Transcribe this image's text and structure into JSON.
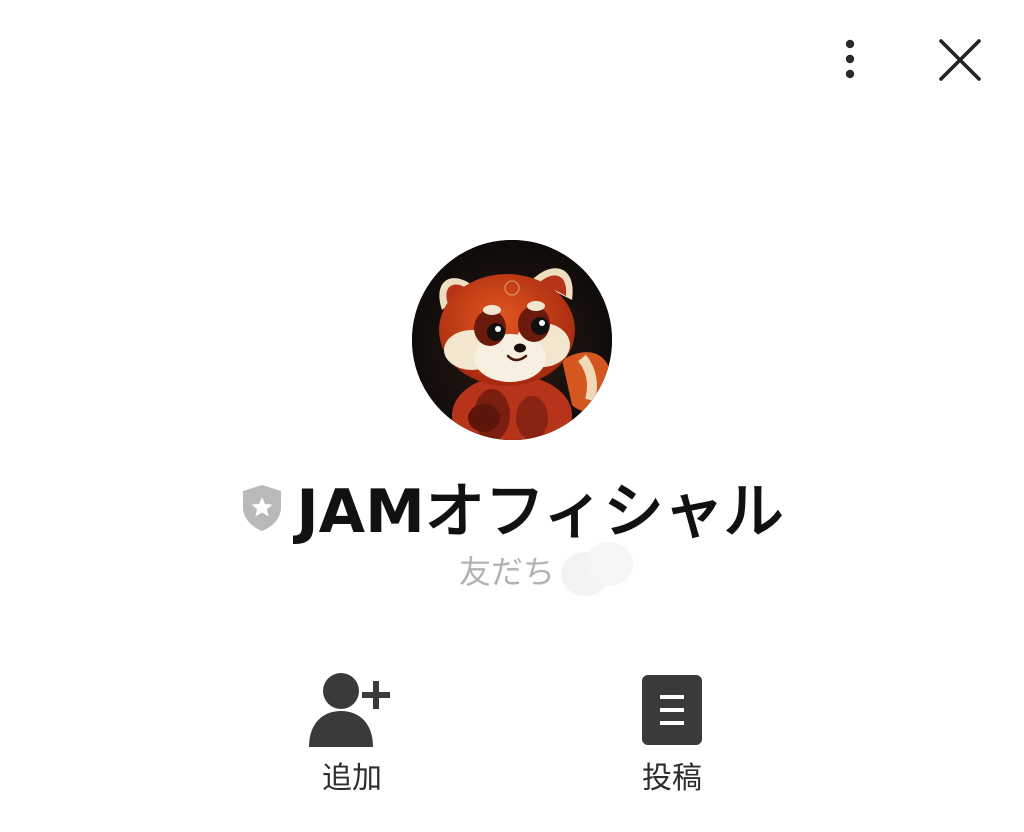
{
  "header": {
    "more_icon": "more-vertical-icon",
    "close_icon": "close-icon"
  },
  "profile": {
    "avatar_description": "red-panda-avatar",
    "badge_icon": "shield-star-icon",
    "name": "JAMオフィシャル",
    "friend_label": "友だち"
  },
  "actions": [
    {
      "label": "追加",
      "icon": "add-friend-icon"
    },
    {
      "label": "投稿",
      "icon": "posts-icon"
    }
  ],
  "colors": {
    "text_primary": "#111111",
    "text_muted": "#b3b3b3",
    "icon_dark": "#3a3a3a",
    "badge_gray": "#b9b9b9"
  }
}
